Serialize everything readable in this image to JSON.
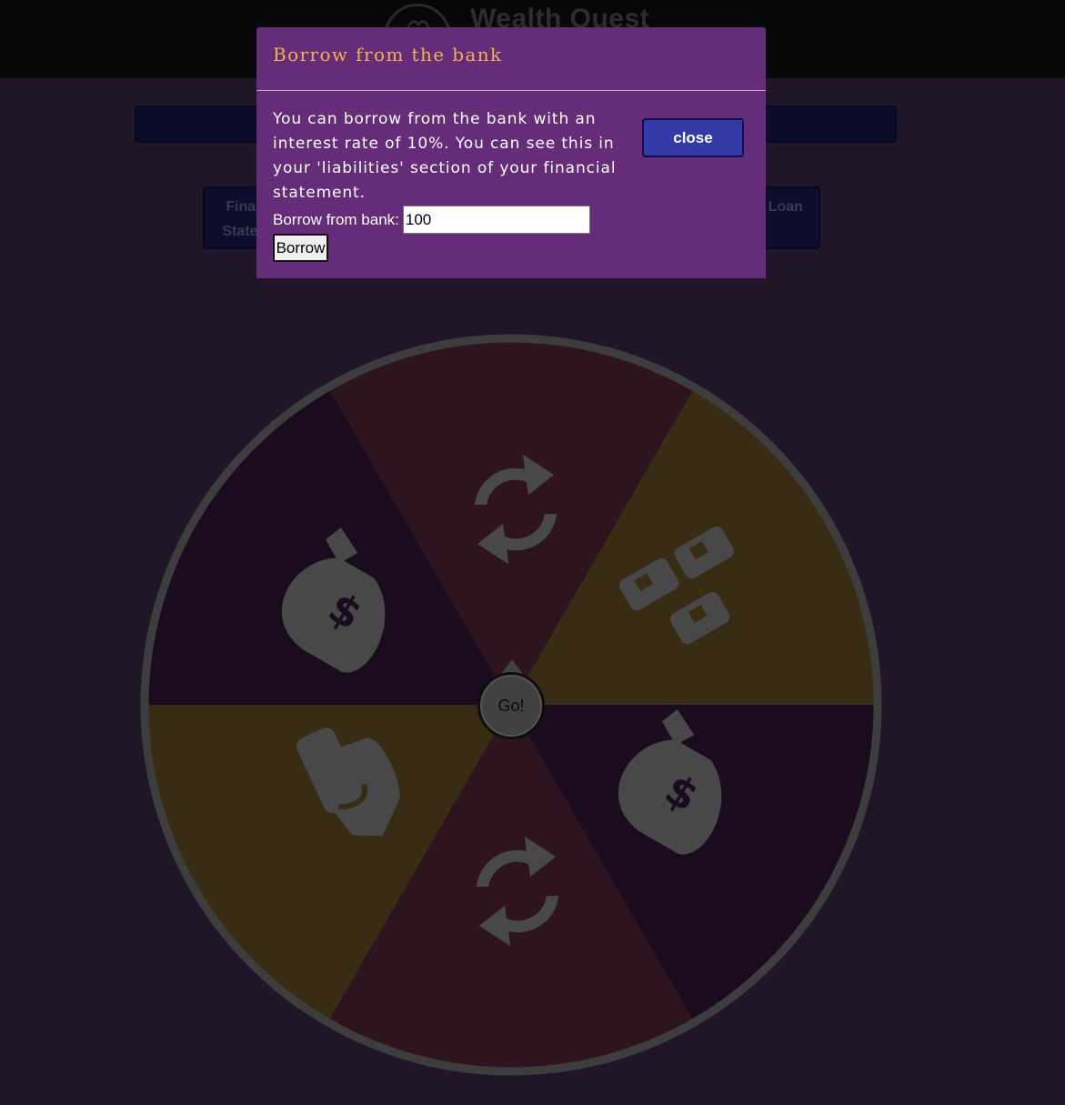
{
  "header": {
    "app_title": "Wealth Quest"
  },
  "nav": {
    "left_button_label": "Financial Statement",
    "right_button_label": "Bank Loan"
  },
  "wheel": {
    "go_label": "Go!",
    "segments": [
      {
        "color": "#2e141f",
        "icon": "refresh-icon"
      },
      {
        "color": "#382c15",
        "icon": "bills-icon"
      },
      {
        "color": "#1a0c1e",
        "icon": "money-bag-icon"
      },
      {
        "color": "#2e141f",
        "icon": "refresh-icon"
      },
      {
        "color": "#382c15",
        "icon": "hand-cash-icon"
      },
      {
        "color": "#1a0c1e",
        "icon": "money-bag-icon"
      }
    ],
    "rim_color": "#3d3d3d",
    "icon_color": "#484848"
  },
  "modal": {
    "title": "Borrow from the bank",
    "description": "You can borrow from the bank with an interest rate of 10%. You can see this in your 'liabilities' section of your financial statement.",
    "close_label": "close",
    "borrow_field_label": "Borrow from bank:",
    "borrow_amount": "100",
    "borrow_button_label": "Borrow"
  }
}
